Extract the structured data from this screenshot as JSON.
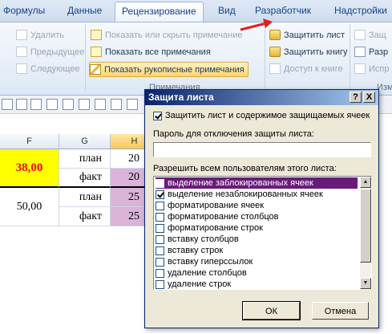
{
  "tabs": [
    "Формулы",
    "Данные",
    "Рецензирование",
    "Вид",
    "Разработчик",
    "Надстройки"
  ],
  "ribbon": {
    "left_items": [
      "Удалить",
      "Предыдущее",
      "Следующее"
    ],
    "center_items": [
      "Показать или скрыть примечание",
      "Показать все примечания",
      "Показать рукописные примечания"
    ],
    "right_items": [
      "Защитить лист",
      "Защитить книгу",
      "Доступ к книге"
    ],
    "far_right_items": [
      "Защ",
      "Разр",
      "Испр"
    ],
    "group_label": "Примечания",
    "group_label_right": "Изм"
  },
  "sheet": {
    "columns": [
      "F",
      "G",
      "H"
    ],
    "f_values": [
      "38,00",
      "50,00"
    ],
    "g_values": [
      "план",
      "факт",
      "план",
      "факт"
    ],
    "h_values": [
      "20",
      "20",
      "25",
      "25"
    ]
  },
  "dialog": {
    "title": "Защита листа",
    "help_glyph": "?",
    "close_glyph": "X",
    "protect_label": "Защитить лист и содержимое защищаемых ячеек",
    "protect_checked": true,
    "password_label": "Пароль для отключения защиты листа:",
    "password_value": "",
    "allow_label": "Разрешить всем пользователям этого листа:",
    "permissions": [
      {
        "label": "выделение заблокированных ячеек",
        "checked": false,
        "selected": true
      },
      {
        "label": "выделение незаблокированных ячеек",
        "checked": true,
        "selected": false
      },
      {
        "label": "форматирование ячеек",
        "checked": false,
        "selected": false
      },
      {
        "label": "форматирование столбцов",
        "checked": false,
        "selected": false
      },
      {
        "label": "форматирование строк",
        "checked": false,
        "selected": false
      },
      {
        "label": "вставку столбцов",
        "checked": false,
        "selected": false
      },
      {
        "label": "вставку строк",
        "checked": false,
        "selected": false
      },
      {
        "label": "вставку гиперссылок",
        "checked": false,
        "selected": false
      },
      {
        "label": "удаление столбцов",
        "checked": false,
        "selected": false
      },
      {
        "label": "удаление строк",
        "checked": false,
        "selected": false
      }
    ],
    "ok_label": "ОК",
    "cancel_label": "Отмена"
  },
  "colors": {
    "accent": "#15428b",
    "highlight_cell": "#ffff00",
    "value_red": "#ff0000",
    "selected_column": "#d9b3d9",
    "dialog_title": "#0a246a",
    "list_selection": "#6a1b7a",
    "arrow": "#e02020"
  },
  "icons": {
    "lock": "lock-icon",
    "comment": "comment-icon",
    "pen": "pen-icon",
    "arrow": "red-arrow-icon"
  }
}
